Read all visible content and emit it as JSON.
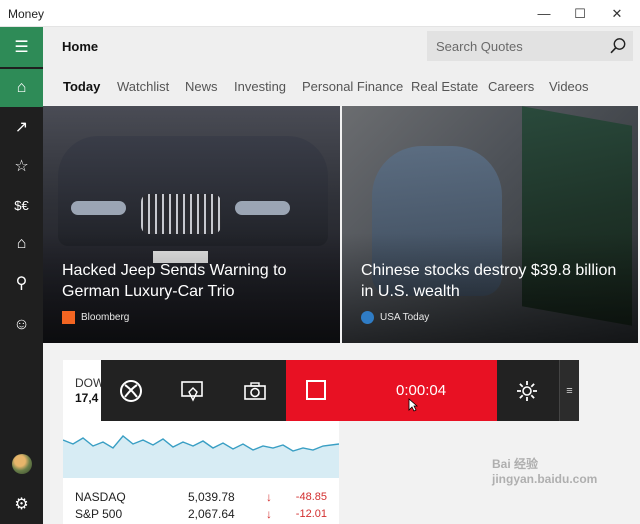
{
  "window": {
    "title": "Money",
    "minimize_glyph": "—",
    "maximize_glyph": "☐",
    "close_glyph": "✕"
  },
  "sidebar": {
    "items": [
      {
        "name": "hamburger-icon",
        "glyph": "☰"
      },
      {
        "name": "home-icon",
        "glyph": "⌂"
      },
      {
        "name": "trend-icon",
        "glyph": "↗"
      },
      {
        "name": "watchlist-icon",
        "glyph": "☆"
      },
      {
        "name": "currency-icon",
        "glyph": "$€"
      },
      {
        "name": "house-icon",
        "glyph": "⌂"
      },
      {
        "name": "chart-person-icon",
        "glyph": "⚲"
      },
      {
        "name": "smiley-icon",
        "glyph": "☺"
      },
      {
        "name": "avatar",
        "glyph": ""
      },
      {
        "name": "gear-icon",
        "glyph": "⚙"
      }
    ]
  },
  "header": {
    "title": "Home",
    "search_placeholder": "Search Quotes"
  },
  "tabs": [
    "Today",
    "Watchlist",
    "News",
    "Investing",
    "Personal Finance",
    "Real Estate",
    "Careers",
    "Videos"
  ],
  "cards": [
    {
      "headline": "Hacked Jeep Sends Warning to German Luxury-Car Trio",
      "source": "Bloomberg",
      "source_color": "#f26522"
    },
    {
      "headline": "Chinese stocks destroy $39.8 billion in U.S. wealth",
      "source": "USA Today",
      "source_color": "#2f7cc5"
    }
  ],
  "market": {
    "dow_label": "DOW",
    "dow_value": "17,4",
    "rows": [
      {
        "name": "NASDAQ",
        "value": "5,039.78",
        "arrow": "↓",
        "change": "-48.85"
      },
      {
        "name": "S&P 500",
        "value": "2,067.64",
        "arrow": "↓",
        "change": "-12.01"
      }
    ]
  },
  "game_bar": {
    "timer": "0:00:04",
    "handle_glyph": "≡"
  },
  "colors": {
    "accent": "#2e8b57",
    "record": "#e81123",
    "down": "#d32f2f"
  },
  "watermark": "Bai 经验 jingyan.baidu.com"
}
